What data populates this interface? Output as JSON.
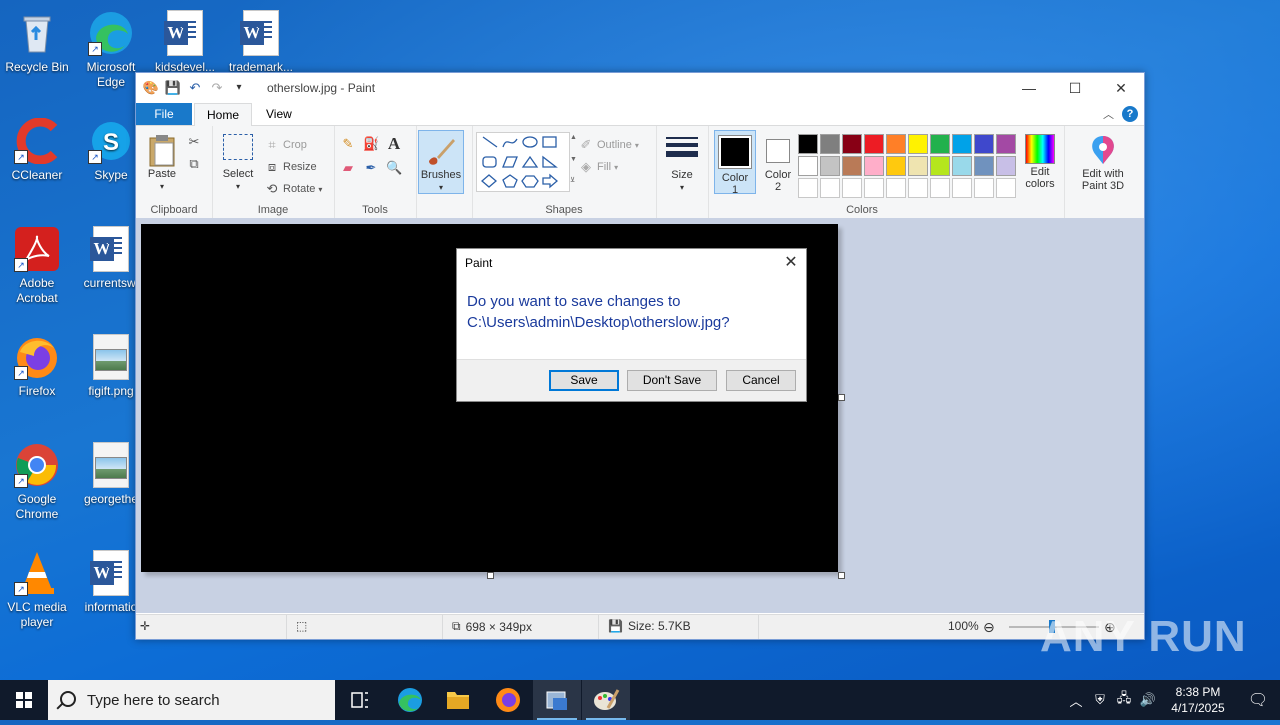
{
  "desktop": {
    "icons": [
      {
        "label": "Recycle Bin"
      },
      {
        "label": "Microsoft Edge"
      },
      {
        "label": "kidsdevel..."
      },
      {
        "label": "trademark..."
      },
      {
        "label": "CCleaner"
      },
      {
        "label": "Skype"
      },
      {
        "label": "Adobe Acrobat"
      },
      {
        "label": "currentswi"
      },
      {
        "label": "Firefox"
      },
      {
        "label": "figift.png"
      },
      {
        "label": "Google Chrome"
      },
      {
        "label": "georgethe"
      },
      {
        "label": "VLC media player"
      },
      {
        "label": "informatio"
      }
    ]
  },
  "paint": {
    "title": "otherslow.jpg - Paint",
    "tabs": {
      "file": "File",
      "home": "Home",
      "view": "View"
    },
    "clipboard": {
      "paste": "Paste",
      "group": "Clipboard"
    },
    "image": {
      "select": "Select",
      "crop": "Crop",
      "resize": "Resize",
      "rotate": "Rotate",
      "group": "Image"
    },
    "tools": {
      "group": "Tools"
    },
    "brushes": "Brushes",
    "shapes": {
      "outline": "Outline",
      "fill": "Fill",
      "group": "Shapes"
    },
    "size": "Size",
    "color1": "Color\n1",
    "color1_line1": "Color",
    "color1_line2": "1",
    "color2_line1": "Color",
    "color2_line2": "2",
    "colors_group": "Colors",
    "edit_colors_line1": "Edit",
    "edit_colors_line2": "colors",
    "paint3d_line1": "Edit with",
    "paint3d_line2": "Paint 3D",
    "palette_row1": [
      "#000000",
      "#7f7f7f",
      "#880015",
      "#ed1c24",
      "#ff7f27",
      "#fff200",
      "#22b14c",
      "#00a2e8",
      "#3f48cc",
      "#a349a4"
    ],
    "palette_row2": [
      "#ffffff",
      "#c3c3c3",
      "#b97a57",
      "#ffaec9",
      "#ffc90e",
      "#efe4b0",
      "#b5e61d",
      "#99d9ea",
      "#7092be",
      "#c8bfe7"
    ],
    "status": {
      "dimensions": "698 × 349px",
      "size": "Size: 5.7KB",
      "zoom": "100%"
    }
  },
  "dialog": {
    "title": "Paint",
    "message_line1": "Do you want to save changes to",
    "message_line2": "C:\\Users\\admin\\Desktop\\otherslow.jpg?",
    "save": "Save",
    "dont_save": "Don't Save",
    "cancel": "Cancel"
  },
  "taskbar": {
    "search_placeholder": "Type here to search",
    "time": "8:38 PM",
    "date": "4/17/2025"
  },
  "watermark": "ANY RUN"
}
